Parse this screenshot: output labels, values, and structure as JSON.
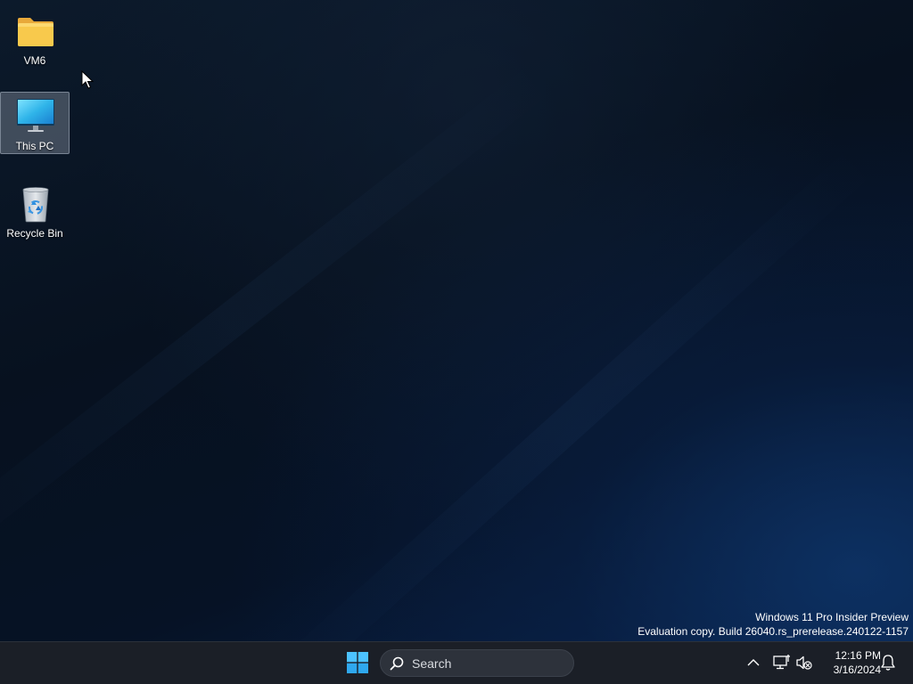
{
  "desktop": {
    "icons": [
      {
        "label": "VM6",
        "icon": "folder-icon",
        "selected": false
      },
      {
        "label": "This PC",
        "icon": "monitor-icon",
        "selected": true
      },
      {
        "label": "Recycle Bin",
        "icon": "recycle-bin-icon",
        "selected": false
      }
    ],
    "watermark": {
      "line1": "Windows 11 Pro Insider Preview",
      "line2": "Evaluation copy. Build 26040.rs_prerelease.240122-1157"
    }
  },
  "taskbar": {
    "start_icon": "windows-logo-icon",
    "search": {
      "placeholder": "Search",
      "icon": "search-icon"
    },
    "tray": {
      "icons": [
        "chevron-up-icon",
        "network-icon",
        "volume-muted-icon",
        "notification-bell-icon"
      ],
      "time": "12:16 PM",
      "date": "3/16/2024"
    }
  },
  "colors": {
    "taskbar_bg": "#1b1f27",
    "accent": "#4cc2ff",
    "folder": "#f8c94c"
  }
}
